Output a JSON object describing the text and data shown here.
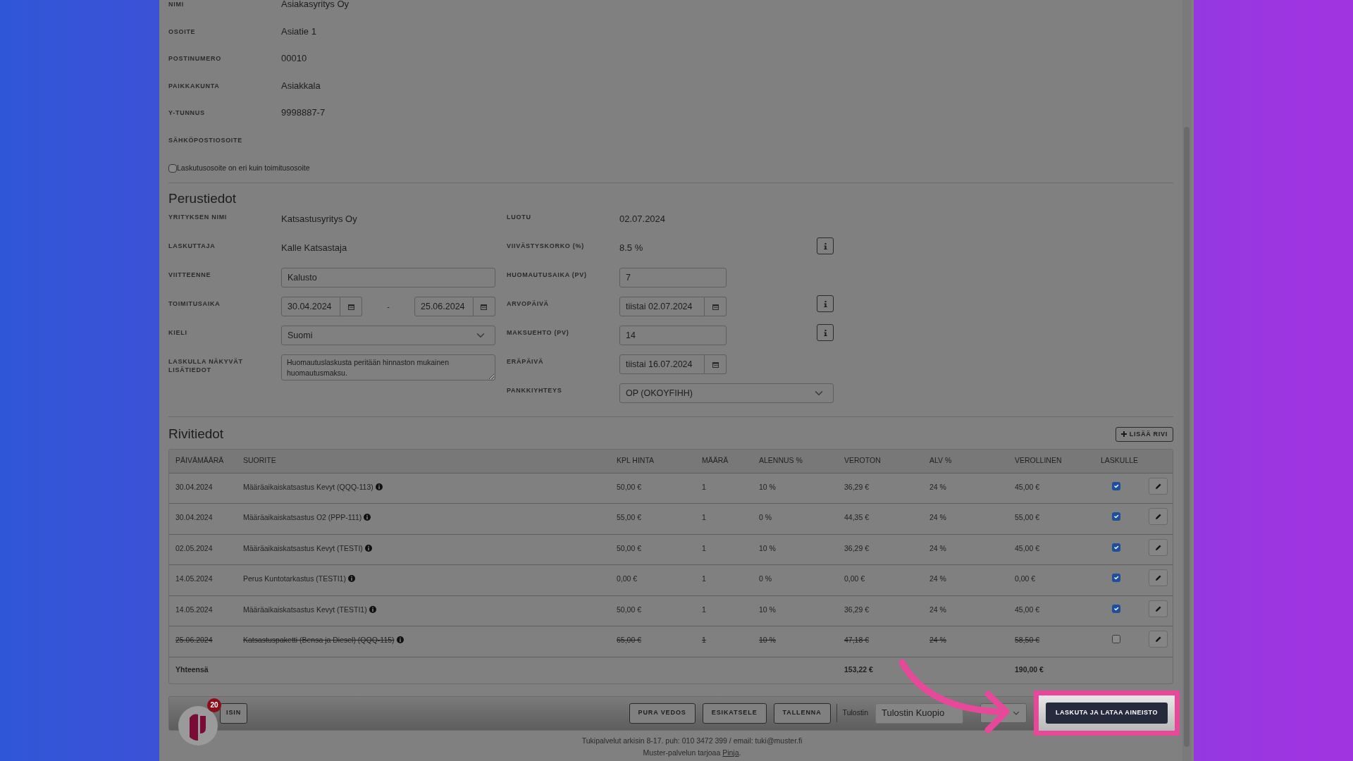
{
  "customer": [
    {
      "label": "NIMI",
      "value": "Asiakasyritys Oy"
    },
    {
      "label": "OSOITE",
      "value": "Asiatie 1"
    },
    {
      "label": "POSTINUMERO",
      "value": "00010"
    },
    {
      "label": "PAIKKAKUNTA",
      "value": "Asiakkala"
    },
    {
      "label": "Y-TUNNUS",
      "value": "9998887-7"
    },
    {
      "label": "SÄHKÖPOSTIOSOITE"
    }
  ],
  "billing_checkbox": {
    "label": "Laskutusosoite on eri kuin toimitusosoite",
    "checked": false
  },
  "basic": {
    "title": "Perustiedot",
    "left": [
      {
        "kind": "text",
        "label": "YRITYKSEN NIMI",
        "value": "Katsastusyritys Oy"
      },
      {
        "kind": "text",
        "label": "LASKUTTAJA",
        "value": "Kalle Katsastaja"
      },
      {
        "kind": "input",
        "label": "VIITTEENNE",
        "value": "Kalusto"
      },
      {
        "kind": "daterange",
        "label": "TOIMITUSAIKA",
        "value": "30.04.2024",
        "separator": "-",
        "value_2": "25.06.2024"
      },
      {
        "kind": "select",
        "label": "KIELI",
        "value": "Suomi"
      },
      {
        "kind": "textarea",
        "label": "LASKULLA NÄKYVÄT LISÄTIEDOT",
        "value": "Huomautuslaskusta peritään hinnaston mukainen huomautusmaksu."
      }
    ],
    "right": [
      {
        "kind": "text",
        "label": "LUOTU",
        "value": "02.07.2024",
        "info": false
      },
      {
        "kind": "text",
        "label": "VIIVÄSTYSKORKO (%)",
        "value": "8.5 %",
        "info": true
      },
      {
        "kind": "input",
        "label": "HUOMAUTUSAIKA (PV)",
        "value": "7",
        "info": false
      },
      {
        "kind": "date",
        "label": "ARVOPÄIVÄ",
        "value": "tiistai 02.07.2024",
        "info": true
      },
      {
        "kind": "input",
        "label": "MAKSUEHTO (PV)",
        "value": "14",
        "info": true
      },
      {
        "kind": "date",
        "label": "ERÄPÄIVÄ",
        "value": "tiistai 16.07.2024",
        "info": false
      },
      {
        "kind": "select",
        "label": "PANKKIYHTEYS",
        "value": "OP (OKOYFIHH)",
        "info": false
      }
    ]
  },
  "rows_section": {
    "title": "Rivitiedot",
    "add_button": "LISÄÄ RIVI",
    "columns": [
      "PÄIVÄMÄÄRÄ",
      "SUORITE",
      "KPL HINTA",
      "MÄÄRÄ",
      "ALENNUS %",
      "VEROTON",
      "ALV %",
      "VEROLLINEN",
      "LASKULLE"
    ],
    "rows": [
      {
        "date": "30.04.2024",
        "item": "Määräaikaiskatsastus Kevyt (QQQ-113)",
        "unit_price": "50,00 €",
        "qty": "1",
        "discount": "10 %",
        "net": "36,29 €",
        "vat": "24 %",
        "gross": "45,00 €",
        "on_invoice": true
      },
      {
        "date": "30.04.2024",
        "item": "Määräaikaiskatsastus O2 (PPP-111)",
        "unit_price": "55,00 €",
        "qty": "1",
        "discount": "0 %",
        "net": "44,35 €",
        "vat": "24 %",
        "gross": "55,00 €",
        "on_invoice": true
      },
      {
        "date": "02.05.2024",
        "item": "Määräaikaiskatsastus Kevyt (TESTI)",
        "unit_price": "50,00 €",
        "qty": "1",
        "discount": "10 %",
        "net": "36,29 €",
        "vat": "24 %",
        "gross": "45,00 €",
        "on_invoice": true
      },
      {
        "date": "14.05.2024",
        "item": "Perus Kuntotarkastus (TESTI1)",
        "unit_price": "0,00 €",
        "qty": "1",
        "discount": "0 %",
        "net": "0,00 €",
        "vat": "24 %",
        "gross": "0,00 €",
        "on_invoice": true
      },
      {
        "date": "14.05.2024",
        "item": "Määräaikaiskatsastus Kevyt (TESTI1)",
        "unit_price": "50,00 €",
        "qty": "1",
        "discount": "10 %",
        "net": "36,29 €",
        "vat": "24 %",
        "gross": "45,00 €",
        "on_invoice": true
      },
      {
        "date": "25.06.2024",
        "item": "Katsastuspaketti (Bensa ja Diesel) (QQQ-115)",
        "unit_price": "65,00 €",
        "qty": "1",
        "discount": "10 %",
        "net": "47,18 €",
        "vat": "24 %",
        "gross": "58,50 €",
        "on_invoice": false
      }
    ],
    "total": {
      "label": "Yhteensä",
      "net": "153,22 €",
      "gross": "190,00 €"
    }
  },
  "action_bar": {
    "back_button": "ISIN",
    "buttons": [
      "PURA VEDOS",
      "ESIKATSELE",
      "TALLENNA"
    ],
    "printer_label": "Tulostin",
    "printer_value": "Tulostin Kuopio",
    "primary_button": "LASKUTA JA LATAA AINEISTO"
  },
  "chat_badge": "20",
  "footer": {
    "line_1": "Tukipalvelut arkisin 8-17. puh: 010 3472 399 / email: tuki@muster.fi",
    "line_2_prefix": "Muster-palvelun tarjoaa ",
    "line_2_link": "Pinja",
    "line_2_suffix": "."
  }
}
